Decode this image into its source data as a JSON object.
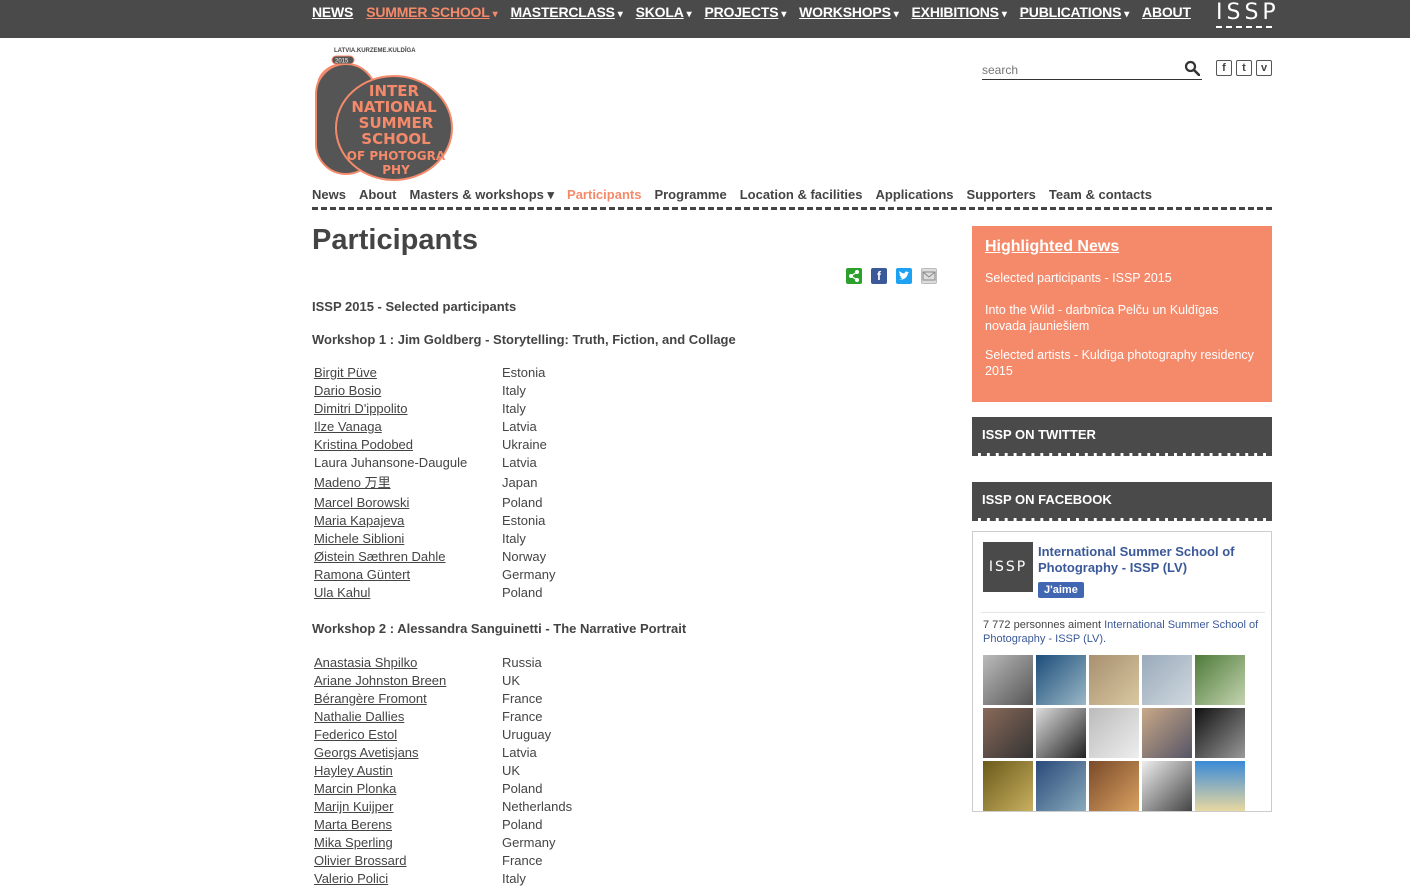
{
  "topnav": {
    "items": [
      {
        "label": "NEWS"
      },
      {
        "label": "SUMMER SCHOOL"
      },
      {
        "label": "MASTERCLASS"
      },
      {
        "label": "SKOLA"
      },
      {
        "label": "PROJECTS"
      },
      {
        "label": "WORKSHOPS"
      },
      {
        "label": "EXHIBITIONS"
      },
      {
        "label": "PUBLICATIONS"
      },
      {
        "label": "ABOUT"
      }
    ],
    "caret": "▾",
    "logo": "ISSP"
  },
  "site_logo": {
    "top_text": "LATVIA.KURZEME.KULDĪGA",
    "year": "2015",
    "lines": [
      "INTER",
      "NATIONAL",
      "SUMMER",
      "SCHOOL",
      "OF PHOTOGRA",
      "PHY"
    ]
  },
  "search": {
    "placeholder": "search"
  },
  "social": {
    "facebook": "f",
    "twitter": "t",
    "vimeo": "v"
  },
  "subnav": {
    "items": [
      {
        "label": "News"
      },
      {
        "label": "About"
      },
      {
        "label": "Masters & workshops ▾"
      },
      {
        "label": "Participants"
      },
      {
        "label": "Programme"
      },
      {
        "label": "Location & facilities"
      },
      {
        "label": "Applications"
      },
      {
        "label": "Supporters"
      },
      {
        "label": "Team & contacts"
      }
    ]
  },
  "main": {
    "title": "Participants",
    "share_fb": "f",
    "subtitle": "ISSP 2015 - Selected participants",
    "workshop1": {
      "title": "Workshop 1 : Jim Goldberg - Storytelling: Truth, Fiction, and Collage",
      "participants": [
        {
          "name": "Birgit Püve",
          "country": "Estonia"
        },
        {
          "name": "Dario Bosio",
          "country": "Italy"
        },
        {
          "name": "Dimitri D'ippolito",
          "country": "Italy"
        },
        {
          "name": "Ilze Vanaga",
          "country": "Latvia"
        },
        {
          "name": "Kristina Podobed",
          "country": "Ukraine"
        },
        {
          "name": "Laura Juhansone-Daugule",
          "country": "Latvia"
        },
        {
          "name": "Madeno 万里",
          "country": "Japan"
        },
        {
          "name": "Marcel Borowski",
          "country": "Poland"
        },
        {
          "name": "Maria Kapajeva",
          "country": "Estonia"
        },
        {
          "name": "Michele Siblioni",
          "country": "Italy"
        },
        {
          "name": "Øistein Sæthren Dahle",
          "country": "Norway"
        },
        {
          "name": "Ramona Güntert",
          "country": "Germany"
        },
        {
          "name": "Ula Kahul",
          "country": "Poland"
        }
      ]
    },
    "workshop2": {
      "title": "Workshop 2 : Alessandra Sanguinetti - The Narrative Portrait",
      "participants": [
        {
          "name": "Anastasia Shpilko",
          "country": "Russia"
        },
        {
          "name": "Ariane Johnston Breen",
          "country": "UK"
        },
        {
          "name": "Bérangère Fromont",
          "country": "France"
        },
        {
          "name": "Nathalie Dallies",
          "country": "France"
        },
        {
          "name": "Federico Estol",
          "country": "Uruguay"
        },
        {
          "name": "Georgs Avetisjans",
          "country": "Latvia"
        },
        {
          "name": "Hayley Austin",
          "country": "UK"
        },
        {
          "name": "Marcin Plonka",
          "country": "Poland"
        },
        {
          "name": "Marijn Kuijper",
          "country": "Netherlands"
        },
        {
          "name": "Marta Berens",
          "country": "Poland"
        },
        {
          "name": "Mika Sperling",
          "country": "Germany"
        },
        {
          "name": "Olivier Brossard",
          "country": "France"
        },
        {
          "name": "Valerio Polici",
          "country": "Italy"
        }
      ]
    }
  },
  "sidebar": {
    "highlighted": {
      "title": "Highlighted News",
      "items": [
        "Selected participants - ISSP 2015",
        "Into the Wild - darbnīca Pelču un Kuldīgas novada jauniešiem",
        "Selected artists - Kuldīga photography residency 2015"
      ]
    },
    "twitter_title": "ISSP ON TWITTER",
    "facebook_title": "ISSP ON FACEBOOK",
    "fb": {
      "logo": "ISSP",
      "page_name": "International Summer School of Photography - ISSP (LV)",
      "like": "J'aime",
      "count_prefix": "7 772 personnes aiment ",
      "count_link": "International Summer School of Photography - ISSP (LV)."
    }
  },
  "colors": {
    "accent": "#f58a6b",
    "bar": "#4a4a4a",
    "text": "#444444",
    "fb": "#3b5998"
  }
}
